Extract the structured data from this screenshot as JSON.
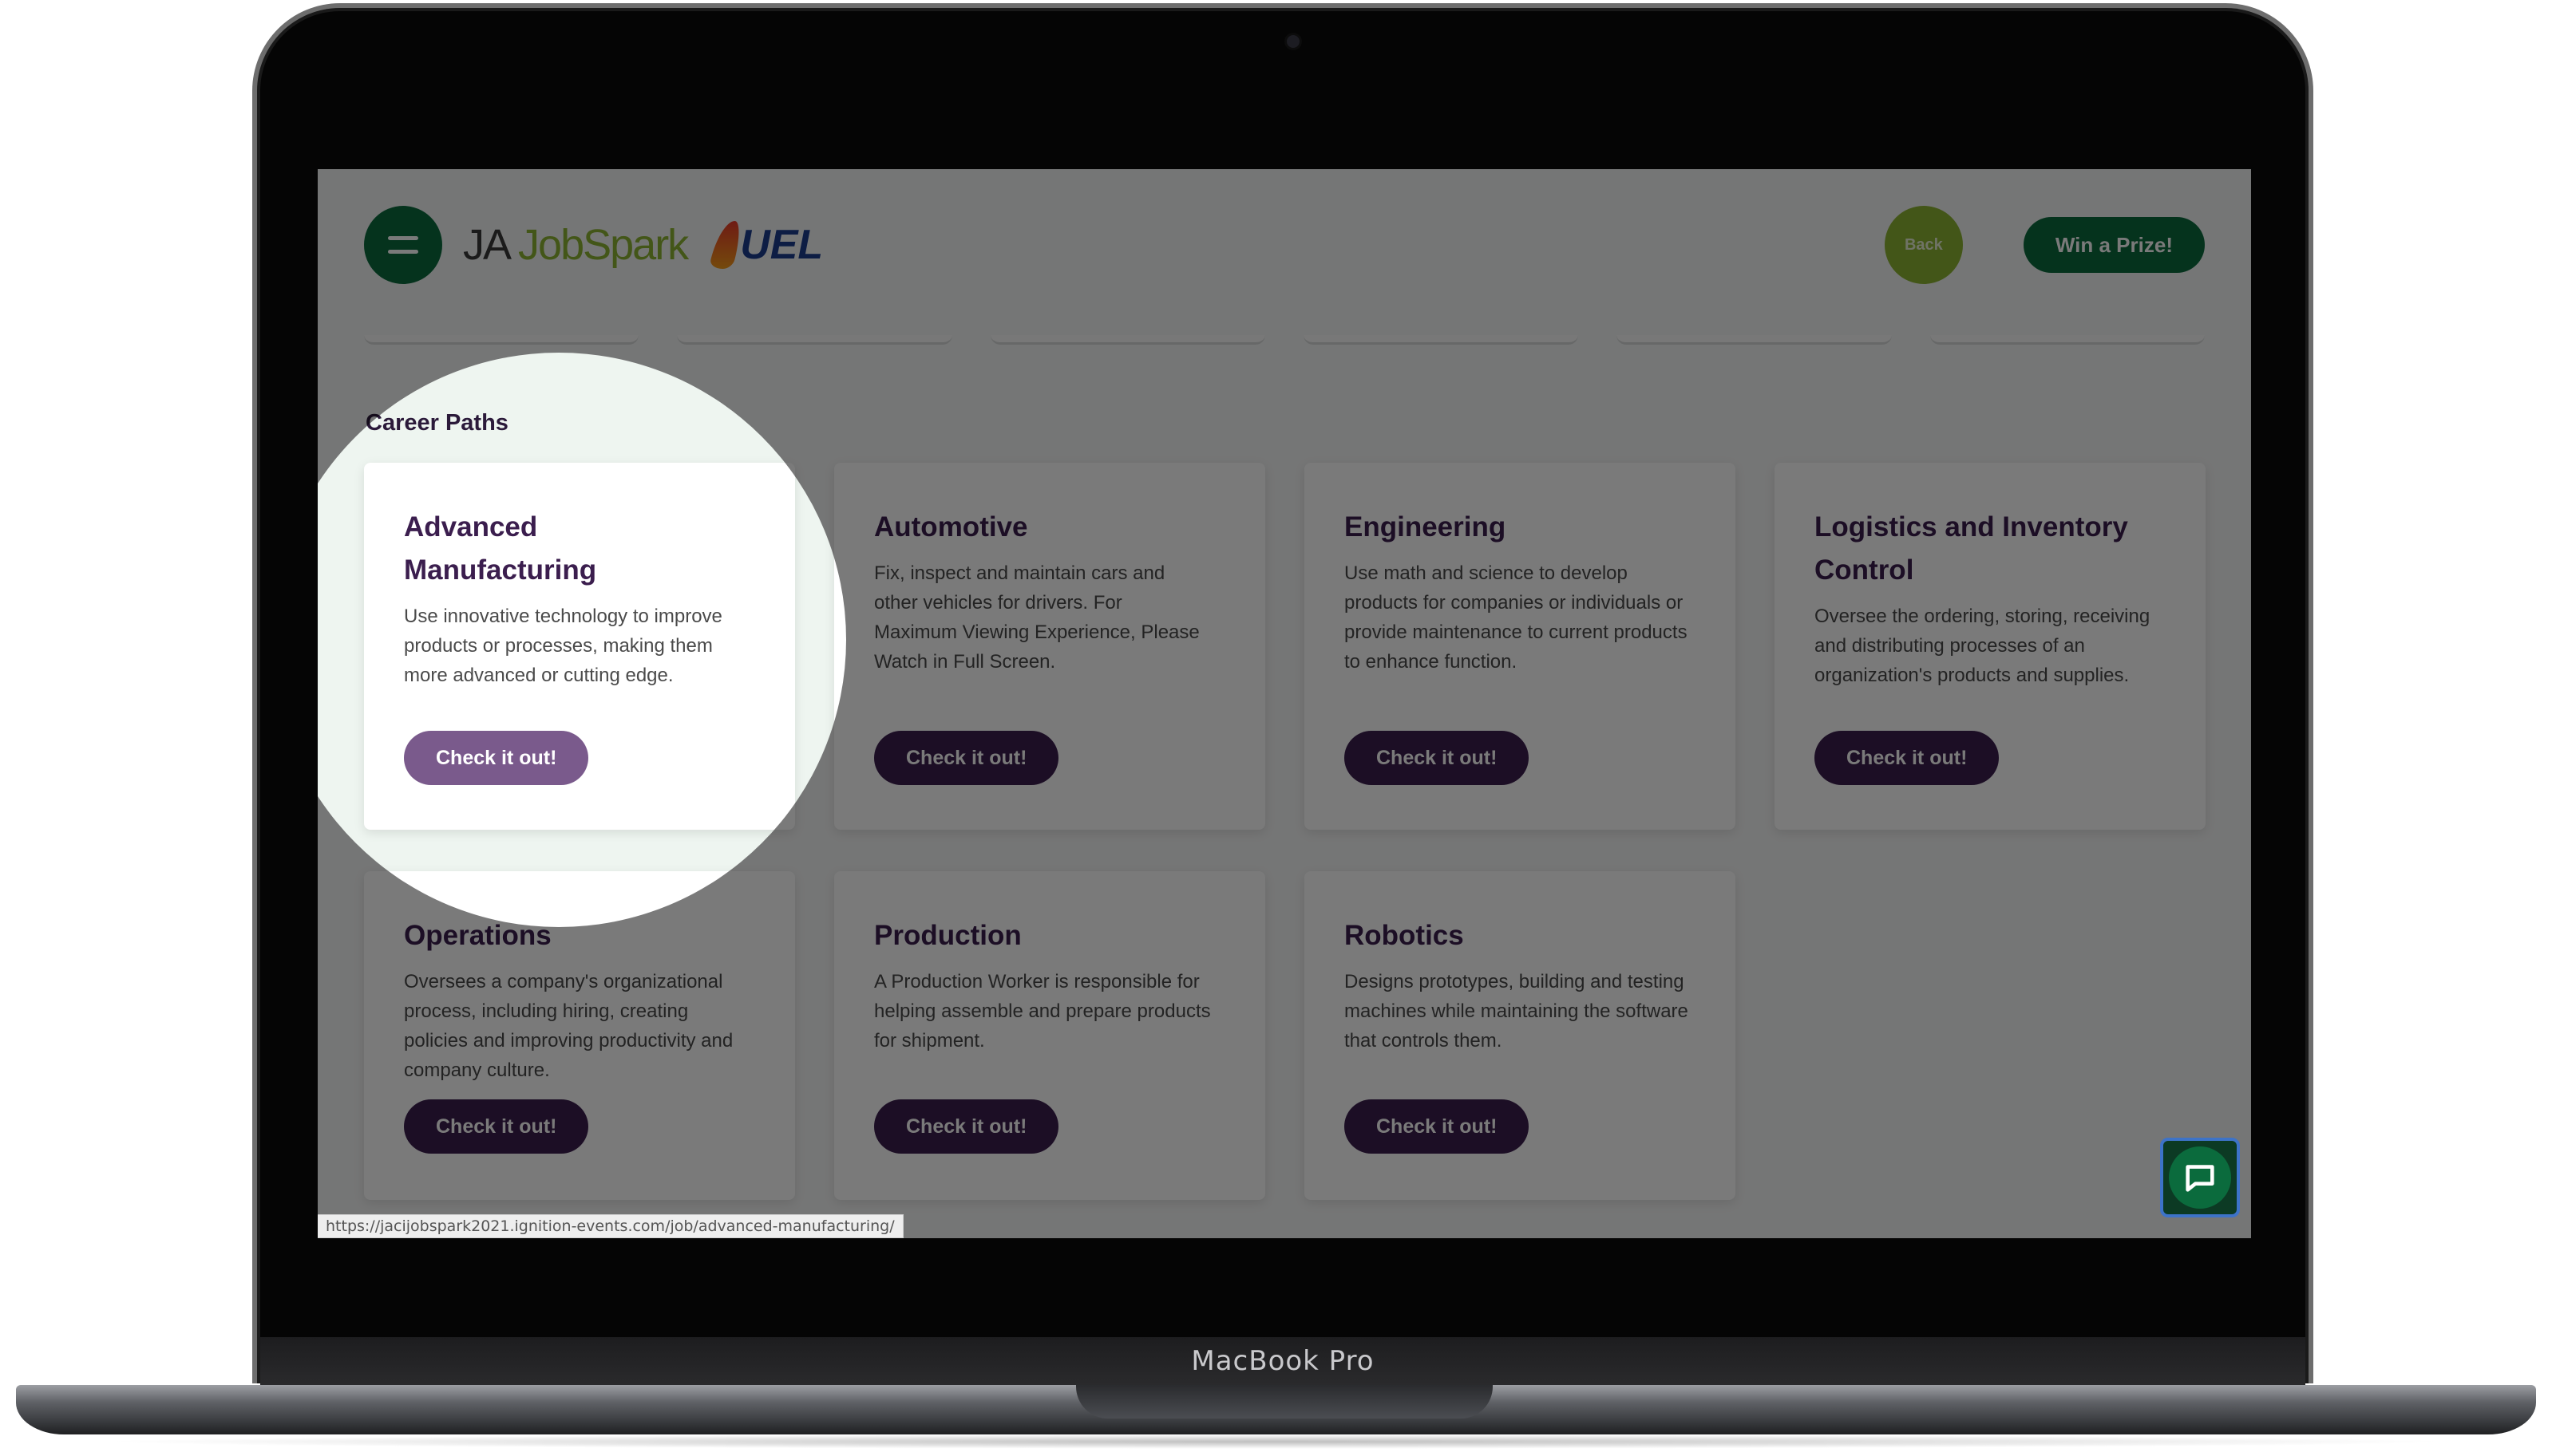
{
  "device": {
    "label": "MacBook Pro"
  },
  "header": {
    "logo_ja": "JA ",
    "logo_jobspark": "JobSpark",
    "logo_fuel": "UEL",
    "back_label": "Back",
    "prize_label": "Win a Prize!"
  },
  "section_title": "Career Paths",
  "cards": [
    {
      "title": "Advanced Manufacturing",
      "desc": "Use innovative technology to improve products or processes, making them more advanced or cutting edge.",
      "cta": "Check it out!"
    },
    {
      "title": "Automotive",
      "desc": "Fix, inspect and maintain cars and other vehicles for drivers. For Maximum Viewing Experience, Please Watch in Full Screen.",
      "cta": "Check it out!"
    },
    {
      "title": "Engineering",
      "desc": "Use math and science to develop products for companies or individuals or provide maintenance to current products to enhance function.",
      "cta": "Check it out!"
    },
    {
      "title": "Logistics and Inventory Control",
      "desc": "Oversee the ordering, storing, receiving and distributing processes of an organization's products and supplies.",
      "cta": "Check it out!"
    },
    {
      "title": "Operations",
      "desc": "Oversees a company's organizational process, including hiring, creating policies and improving productivity and company culture.",
      "cta": "Check it out!"
    },
    {
      "title": "Production",
      "desc": "A Production Worker is responsible for helping assemble and prepare products for shipment.",
      "cta": "Check it out!"
    },
    {
      "title": "Robotics",
      "desc": "Designs prototypes, building and testing machines while maintaining the software that controls them.",
      "cta": "Check it out!"
    }
  ],
  "status_url": "https://jacijobspark2021.ignition-events.com/job/advanced-manufacturing/",
  "icons": {
    "menu": "hamburger-icon",
    "chat": "chat-bubble-icon",
    "logo_flame": "flame-icon"
  },
  "colors": {
    "brand_green": "#0b6b3d",
    "accent_lime": "#8db533",
    "cta_purple": "#3b1e4e",
    "cta_highlight": "#7a5a8c"
  }
}
